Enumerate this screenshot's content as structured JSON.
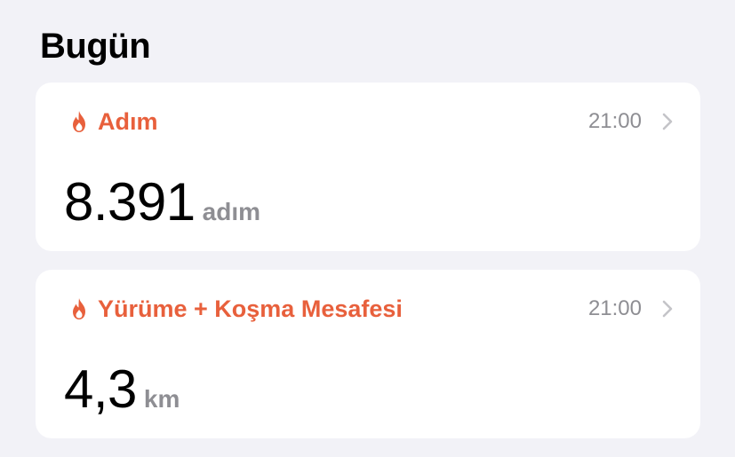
{
  "section": {
    "title": "Bugün"
  },
  "cards": [
    {
      "title": "Adım",
      "time": "21:00",
      "value": "8.391",
      "unit": "adım",
      "icon": "flame-icon"
    },
    {
      "title": "Yürüme + Koşma Mesafesi",
      "time": "21:00",
      "value": "4,3",
      "unit": "km",
      "icon": "flame-icon"
    }
  ],
  "colors": {
    "accent": "#e8603c",
    "background": "#f2f2f7",
    "card": "#ffffff",
    "secondary_text": "#8e8e93"
  }
}
